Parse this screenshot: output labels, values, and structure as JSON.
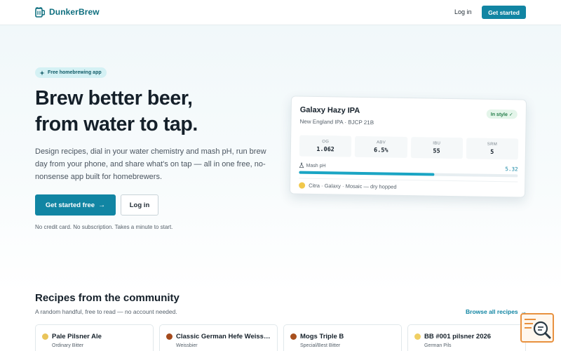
{
  "header": {
    "brand": "DunkerBrew",
    "login": "Log in",
    "cta": "Get started"
  },
  "colors": {
    "accent": "#1185a3",
    "brand_text": "#0f6f7f",
    "badge_bg": "#d4f1f4",
    "status_bg": "#e4f5ea",
    "status_text": "#1f7a45",
    "ph_bar": "#1aa5c4",
    "widget_border": "#e8913f"
  },
  "hero": {
    "badge": "Free homebrewing app",
    "title_line1": "Brew better beer,",
    "title_line2": "from water to tap.",
    "description": "Design recipes, dial in your water chemistry and mash pH, run brew day from your phone, and share what's on tap — all in one free, no-nonsense app built for homebrewers.",
    "primary_button": "Get started free",
    "secondary_button": "Log in",
    "note": "No credit card. No subscription. Takes a minute to start."
  },
  "recipe_card": {
    "name": "Galaxy Hazy IPA",
    "style": "New England IPA · BJCP 21B",
    "status": "In style ✓",
    "stats": [
      {
        "label": "OG",
        "value": "1.062"
      },
      {
        "label": "ABV",
        "value": "6.5%"
      },
      {
        "label": "IBU",
        "value": "55"
      },
      {
        "label": "SRM",
        "value": "5"
      }
    ],
    "ph_label": "Mash pH",
    "ph_value": "5.32",
    "ph_fill_fraction": 0.62,
    "hops": "Citra · Galaxy · Mosaic — dry hopped"
  },
  "community": {
    "title": "Recipes from the community",
    "subtitle": "A random handful, free to read — no account needed.",
    "browse_link": "Browse all recipes",
    "recipes": [
      {
        "name": "Pale Pilsner Ale",
        "style": "Ordinary Bitter",
        "color": "#e9c45a"
      },
      {
        "name": "Classic German Hefe Weissbier",
        "style": "Weissbier",
        "color": "#a44a1c"
      },
      {
        "name": "Mogs Triple B",
        "style": "Special/Best Bitter",
        "color": "#a8501e"
      },
      {
        "name": "BB #001 pilsner 2026",
        "style": "German Pils",
        "color": "#f0cf63"
      }
    ]
  },
  "icons": {
    "brand": "beer-mug-icon",
    "badge": "sparkle-icon",
    "arrow": "arrow-right-icon",
    "ph": "flask-icon",
    "widget": "search-chat-icon"
  }
}
